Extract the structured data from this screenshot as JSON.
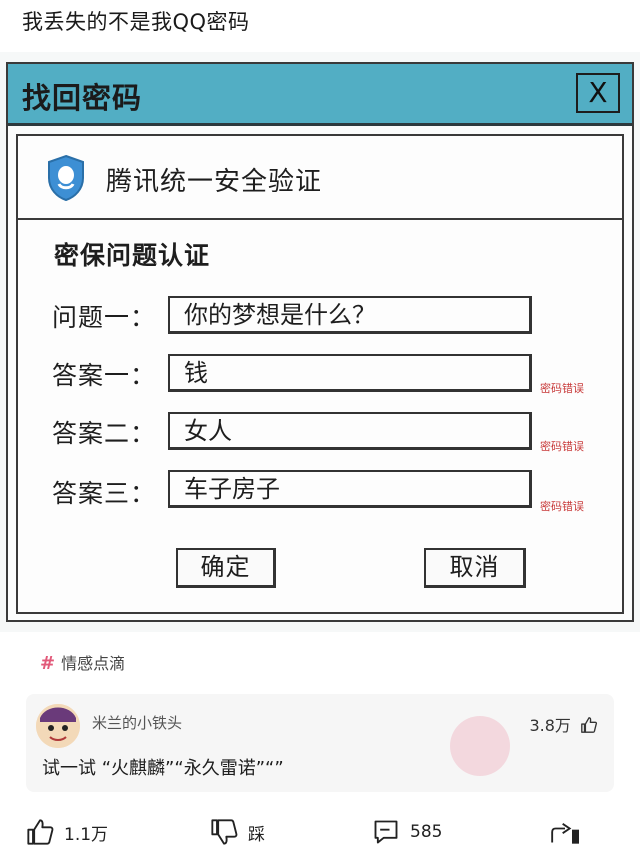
{
  "post": {
    "title": "我丢失的不是我QQ密码"
  },
  "dialog": {
    "title": "找回密码",
    "close_label": "X",
    "verify_title": "腾讯统一安全验证",
    "section_title": "密保问题认证",
    "rows": [
      {
        "label": "问题一：",
        "value": "你的梦想是什么？",
        "error": ""
      },
      {
        "label": "答案一：",
        "value": "钱",
        "error": "密码错误"
      },
      {
        "label": "答案二：",
        "value": "女人",
        "error": "密码错误"
      },
      {
        "label": "答案三：",
        "value": "车子房子",
        "error": "密码错误"
      }
    ],
    "confirm_label": "确定",
    "cancel_label": "取消"
  },
  "topic": {
    "label": "情感点滴"
  },
  "comment": {
    "user": "米兰的小铁头",
    "likes": "3.8万",
    "text": "试一试 “火麒麟”“永久雷诺”“”"
  },
  "actions": {
    "like_count": "1.1万",
    "dislike_label": "踩",
    "comment_count": "585"
  },
  "colors": {
    "titlebar": "#52aec4",
    "error": "#c83a3a",
    "topic_hash": "#e25a7a"
  }
}
